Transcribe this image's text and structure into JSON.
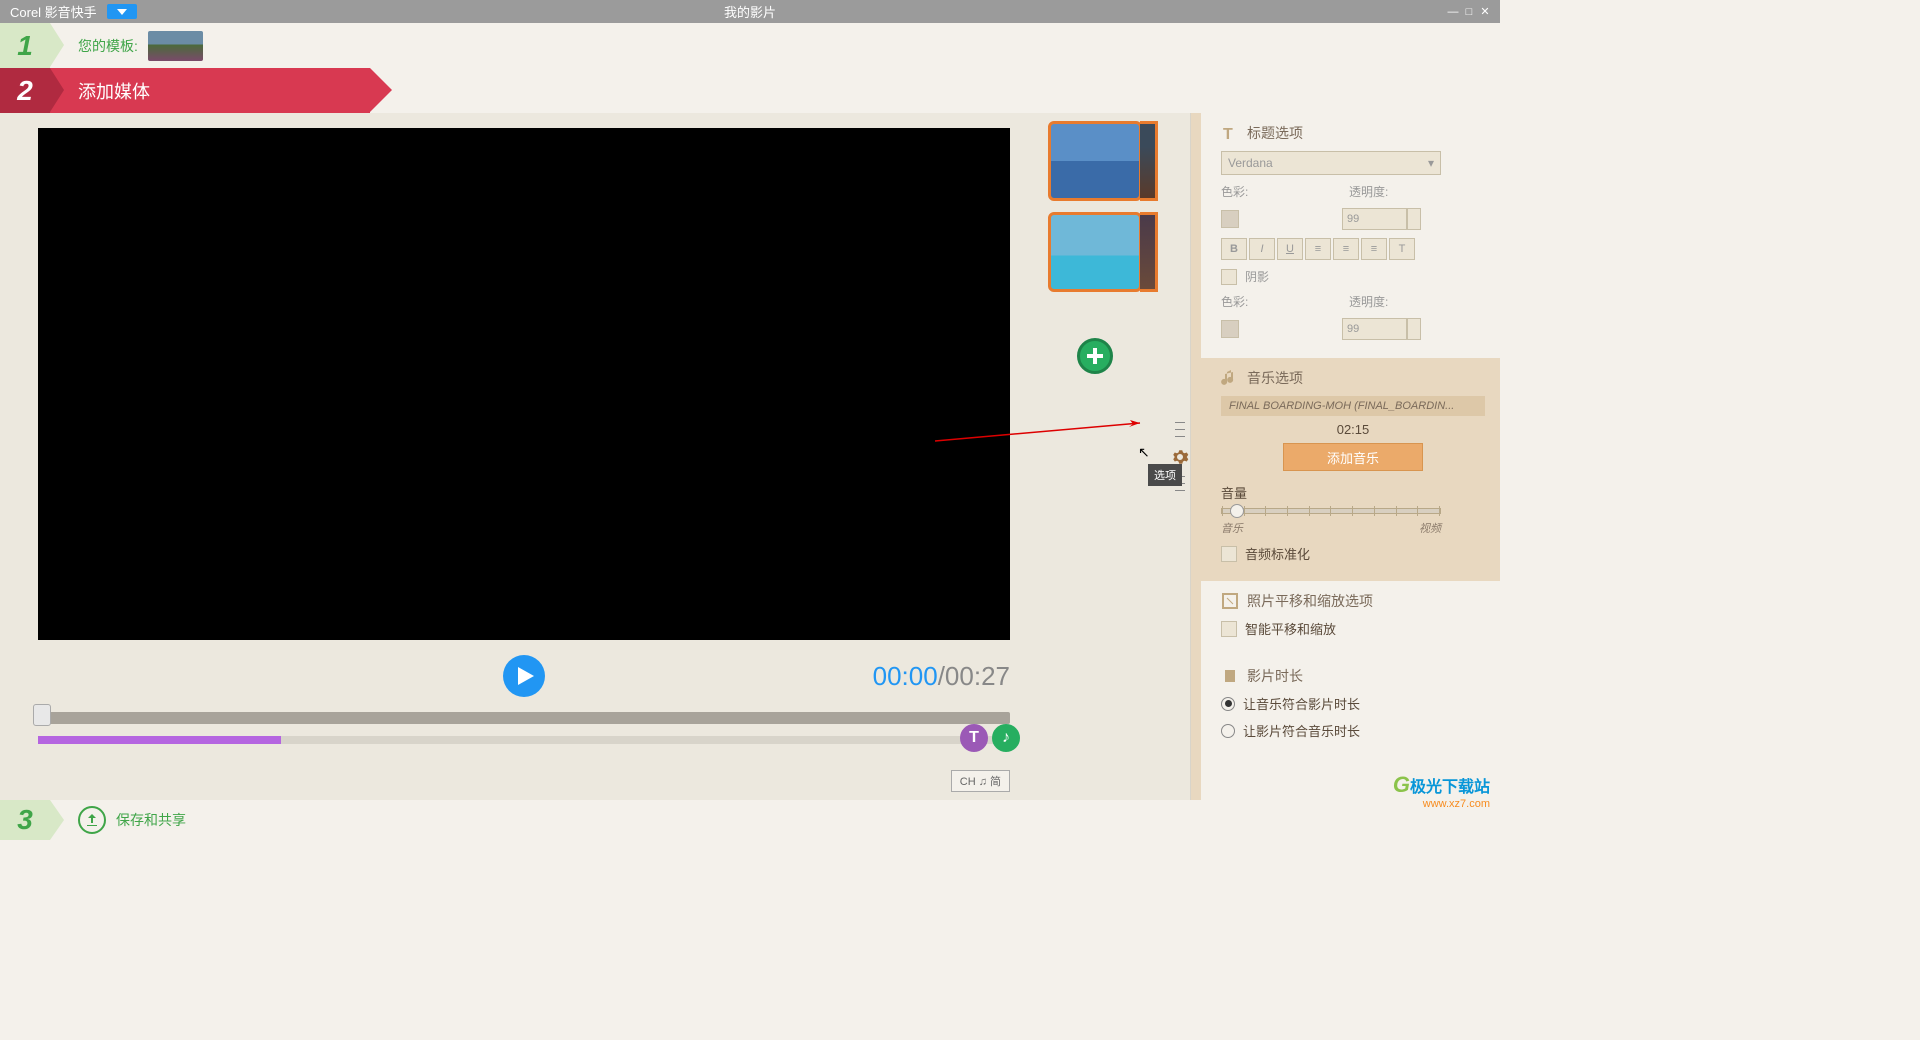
{
  "titlebar": {
    "app_name": "Corel 影音快手",
    "project_name": "我的影片"
  },
  "steps": {
    "step1": {
      "num": "1",
      "label": "您的模板:"
    },
    "step2": {
      "num": "2",
      "label": "添加媒体"
    },
    "step3": {
      "num": "3",
      "label": "保存和共享"
    }
  },
  "player": {
    "current": "00:00",
    "separator": "/",
    "total": "00:27"
  },
  "ime": "CH ♫ 简",
  "right": {
    "title_options": {
      "header": "标题选项",
      "font": "Verdana",
      "color_label": "色彩:",
      "opacity_label": "透明度:",
      "opacity_value": "99",
      "shadow": "阴影",
      "color_label2": "色彩:",
      "opacity_label2": "透明度:",
      "opacity_value2": "99"
    },
    "fmt": {
      "b": "B",
      "i": "I",
      "u": "U",
      "t": "T"
    },
    "music_options": {
      "header": "音乐选项",
      "track_name": "FINAL BOARDING-MOH (FINAL_BOARDIN...",
      "duration": "02:15",
      "add_button": "添加音乐",
      "volume_label": "音量",
      "vol_left": "音乐",
      "vol_right": "视频",
      "normalize": "音频标准化"
    },
    "pan_zoom": {
      "header": "照片平移和缩放选项",
      "smart": "智能平移和缩放"
    },
    "duration": {
      "header": "影片时长",
      "option1": "让音乐符合影片时长",
      "option2": "让影片符合音乐时长"
    }
  },
  "tooltip": "选项",
  "watermark": {
    "text": "极光下载站",
    "url": "www.xz7.com"
  },
  "timeline_icons": {
    "t": "T",
    "m": "♪"
  }
}
